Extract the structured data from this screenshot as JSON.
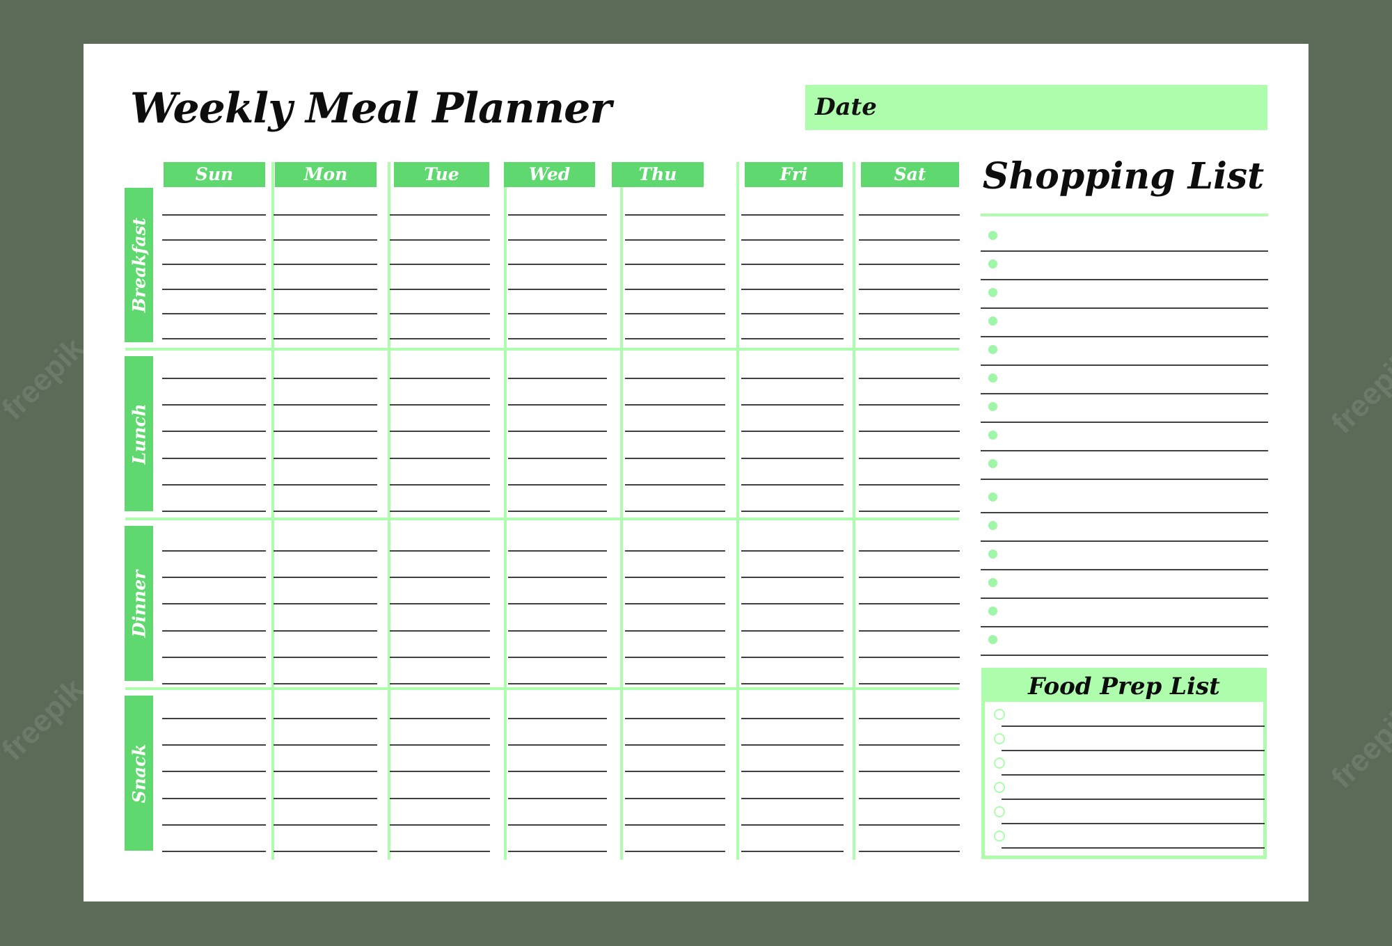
{
  "page": {
    "title": "Weekly Meal Planner",
    "date_label": "Date",
    "watermark": "freepik"
  },
  "days": [
    "Sun",
    "Mon",
    "Tue",
    "Wed",
    "Thu",
    "Fri",
    "Sat"
  ],
  "meals": [
    {
      "label": "Breakfast",
      "lines": 6
    },
    {
      "label": "Lunch",
      "lines": 6
    },
    {
      "label": "Dinner",
      "lines": 6
    },
    {
      "label": "Snack",
      "lines": 6
    }
  ],
  "shopping_list": {
    "title": "Shopping List",
    "item_count": 15,
    "items": [
      "",
      "",
      "",
      "",
      "",
      "",
      "",
      "",
      "",
      "",
      "",
      "",
      "",
      "",
      ""
    ]
  },
  "food_prep_list": {
    "title": "Food Prep List",
    "item_count": 6,
    "items": [
      "",
      "",
      "",
      "",
      "",
      ""
    ]
  },
  "colors": {
    "background": "#5b6b58",
    "paper": "#ffffff",
    "accent_dark_green": "#5fd96f",
    "accent_light_green": "#adfdad",
    "text": "#0d0d0d",
    "rule_line": "#3f3f3f"
  }
}
